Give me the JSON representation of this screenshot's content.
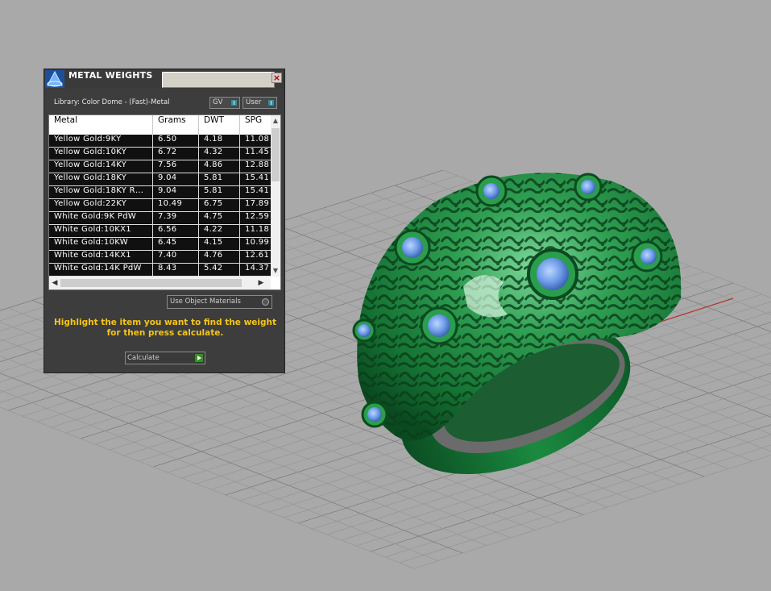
{
  "colors": {
    "background": "#a9a9a9",
    "grid": "#8f8f8f",
    "ring": "#1f8a3e",
    "gem": "#6d9ce8",
    "hint_text": "#f5c518"
  },
  "panel": {
    "title": "METAL WEIGHTS",
    "close_icon": "close-icon",
    "library_label": "Library: Color Dome - (Fast)-Metal",
    "gv_label": "GV",
    "user_label": "User",
    "columns": [
      "Metal",
      "Grams",
      "DWT",
      "SPG"
    ],
    "rows": [
      {
        "metal": "Yellow Gold:9KY",
        "grams": "6.50",
        "dwt": "4.18",
        "spg": "11.08"
      },
      {
        "metal": "Yellow Gold:10KY",
        "grams": "6.72",
        "dwt": "4.32",
        "spg": "11.45"
      },
      {
        "metal": "Yellow Gold:14KY",
        "grams": "7.56",
        "dwt": "4.86",
        "spg": "12.88"
      },
      {
        "metal": "Yellow Gold:18KY",
        "grams": "9.04",
        "dwt": "5.81",
        "spg": "15.41"
      },
      {
        "metal": "Yellow Gold:18KY R…",
        "grams": "9.04",
        "dwt": "5.81",
        "spg": "15.41"
      },
      {
        "metal": "Yellow Gold:22KY",
        "grams": "10.49",
        "dwt": "6.75",
        "spg": "17.89"
      },
      {
        "metal": "White Gold:9K PdW",
        "grams": "7.39",
        "dwt": "4.75",
        "spg": "12.59"
      },
      {
        "metal": "White Gold:10KX1",
        "grams": "6.56",
        "dwt": "4.22",
        "spg": "11.18"
      },
      {
        "metal": "White Gold:10KW",
        "grams": "6.45",
        "dwt": "4.15",
        "spg": "10.99"
      },
      {
        "metal": "White Gold:14KX1",
        "grams": "7.40",
        "dwt": "4.76",
        "spg": "12.61"
      },
      {
        "metal": "White Gold:14K PdW",
        "grams": "8.43",
        "dwt": "5.42",
        "spg": "14.37"
      }
    ],
    "use_object_label": "Use Object Materials",
    "hint": "Highlight the item you want to find the weight for then press calculate.",
    "calculate_label": "Calculate"
  }
}
